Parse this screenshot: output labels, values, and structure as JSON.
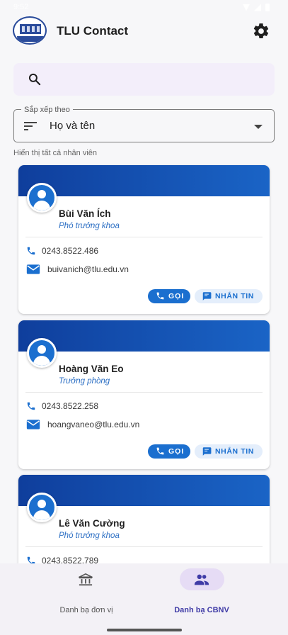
{
  "app": {
    "title": "TLU Contact",
    "logo_text": "TLU"
  },
  "status": {
    "time": "9:52"
  },
  "search": {
    "placeholder": ""
  },
  "sort": {
    "label": "Sắp xếp theo",
    "value": "Họ và tên"
  },
  "hint": "Hiển thị tất cả nhân viên",
  "employees": [
    {
      "name": "Bùi Văn Ích",
      "role": "Phó trưởng khoa",
      "phone": "0243.8522.486",
      "email": "buivanich@tlu.edu.vn"
    },
    {
      "name": "Hoàng Văn Eo",
      "role": "Trưởng phòng",
      "phone": "0243.8522.258",
      "email": "hoangvaneo@tlu.edu.vn"
    },
    {
      "name": "Lê Văn Cường",
      "role": "Phó trưởng khoa",
      "phone": "0243.8522.789",
      "email": ""
    }
  ],
  "actions": {
    "call": "GỌI",
    "message": "NHẮN TIN"
  },
  "nav": [
    {
      "label": "Danh bạ đơn vị",
      "active": false
    },
    {
      "label": "Danh bạ CBNV",
      "active": true
    }
  ],
  "colors": {
    "primary": "#1b6fcf",
    "band_start": "#0f3e9c",
    "band_end": "#1a64c6",
    "nav_active": "#3f3ba6"
  }
}
